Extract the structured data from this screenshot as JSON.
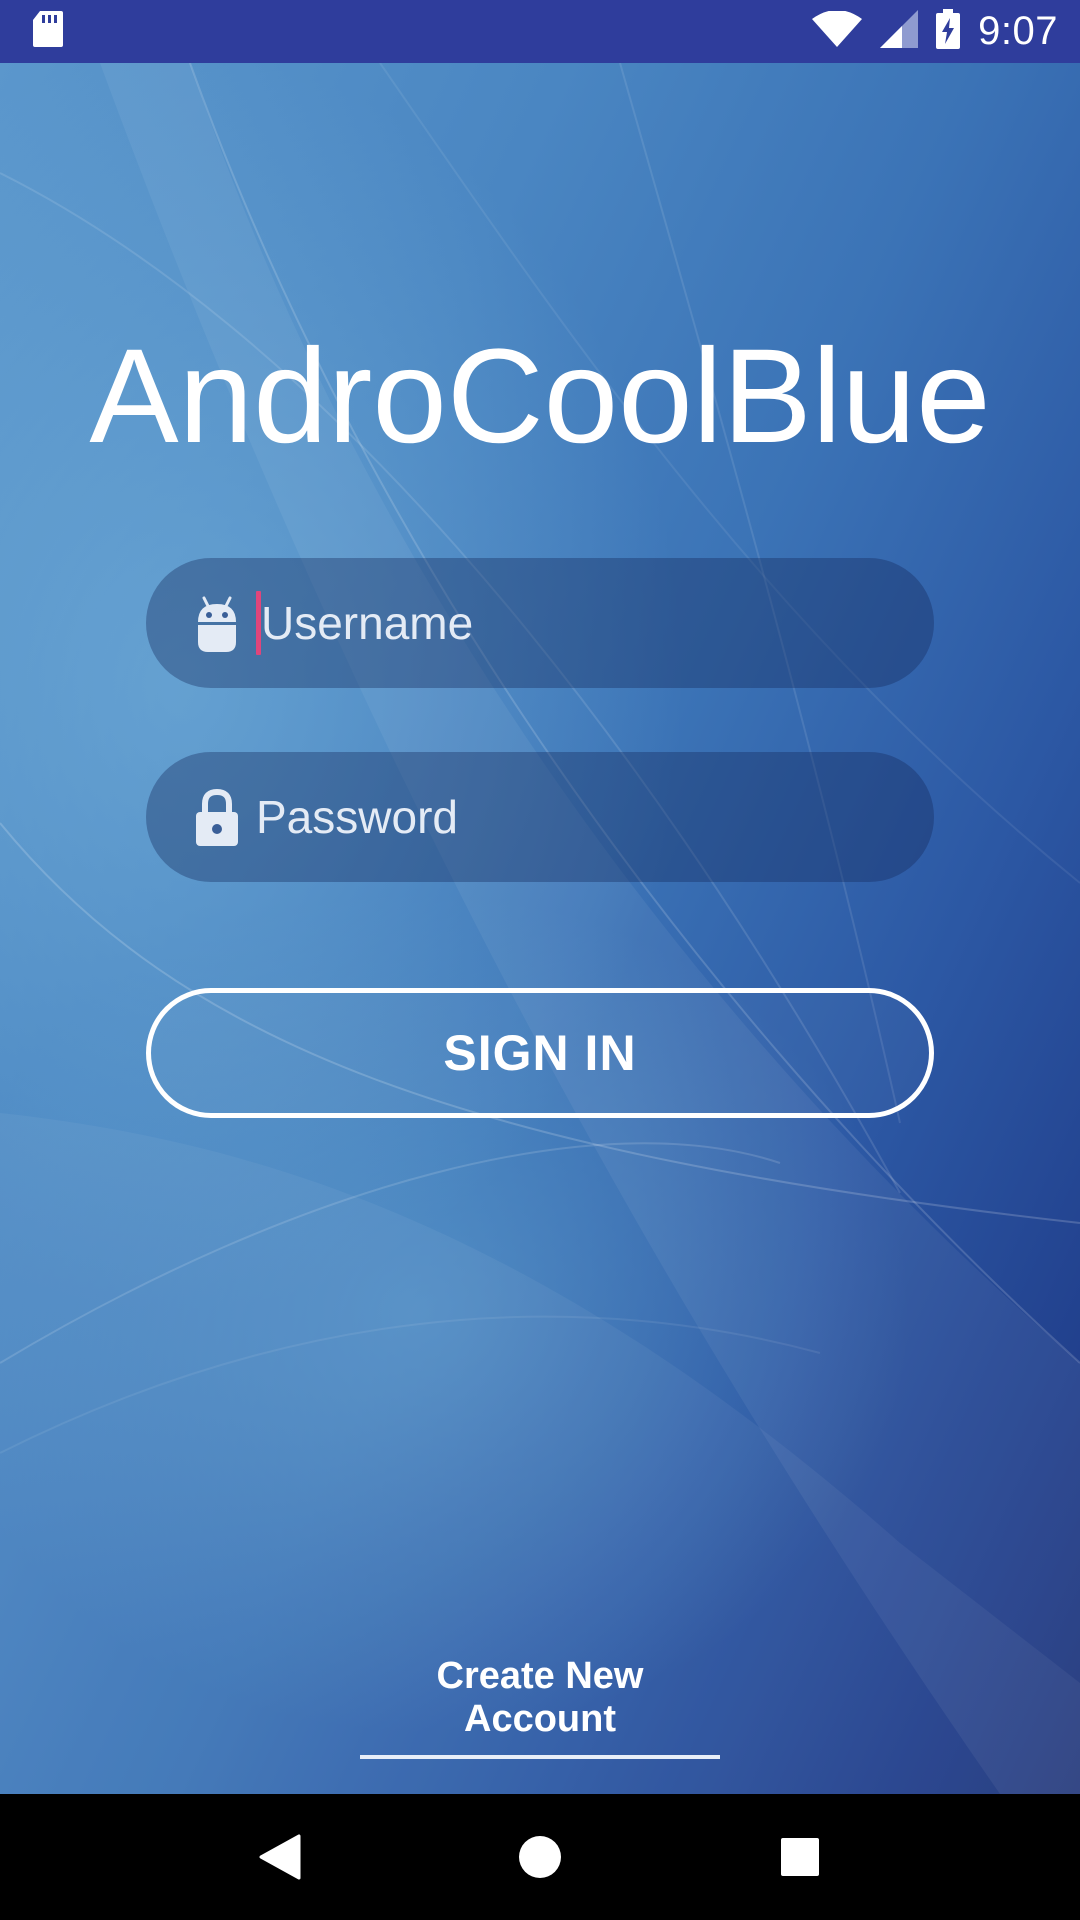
{
  "status_bar": {
    "time": "9:07",
    "icons": [
      "sd-card-icon",
      "wifi-icon",
      "signal-icon",
      "battery-charging-icon"
    ]
  },
  "app": {
    "title": "AndroCoolBlue"
  },
  "form": {
    "username": {
      "placeholder": "Username",
      "value": "",
      "icon": "android-icon"
    },
    "password": {
      "placeholder": "Password",
      "value": "",
      "icon": "lock-icon"
    },
    "sign_in_label": "SIGN IN",
    "create_account_label": "Create New Account"
  },
  "colors": {
    "status_bar": "#2f3d9c",
    "cursor": "#e0457b",
    "background_dark": "#1e3478",
    "background_light": "#5b97cc"
  },
  "navigation": {
    "buttons": [
      "back-icon",
      "home-icon",
      "recents-icon"
    ]
  }
}
